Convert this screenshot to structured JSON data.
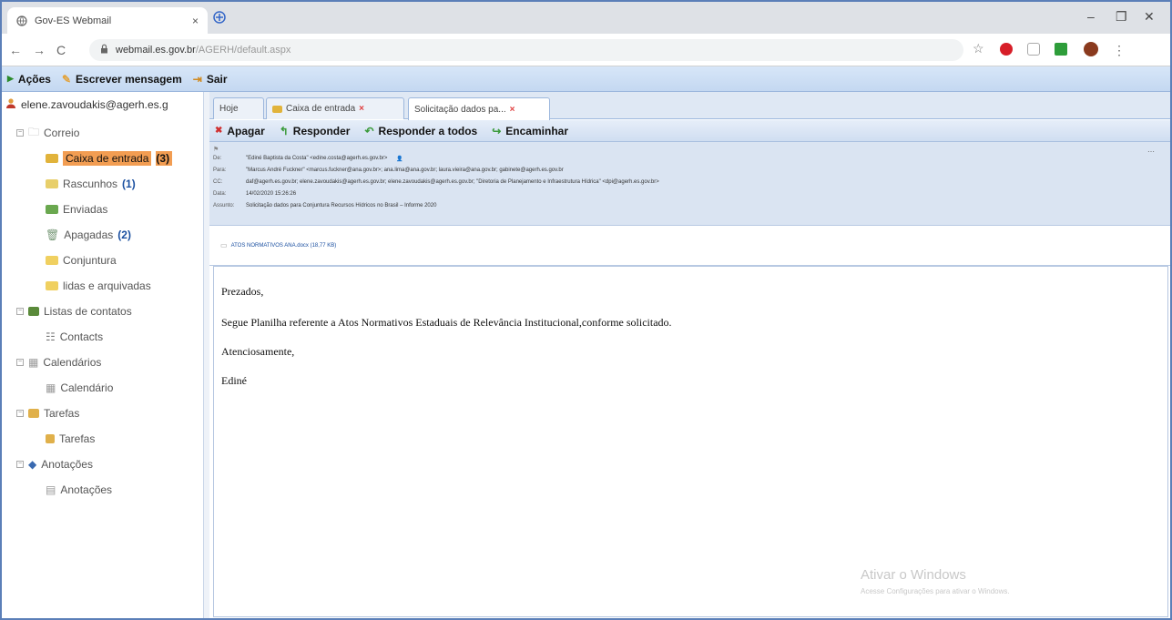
{
  "browser": {
    "tab_title": "Gov-ES Webmail",
    "url_domain": "webmail.es.gov.br",
    "url_path": "/AGERH/default.aspx"
  },
  "toolbar": {
    "actions": "Ações",
    "compose": "Escrever mensagem",
    "logout": "Sair"
  },
  "sidebar": {
    "account": "elene.zavoudakis@agerh.es.g",
    "correio": "Correio",
    "inbox": "Caixa de entrada",
    "inbox_count": "(3)",
    "drafts": "Rascunhos",
    "drafts_count": "(1)",
    "sent": "Enviadas",
    "deleted": "Apagadas",
    "deleted_count": "(2)",
    "conjuntura": "Conjuntura",
    "archived": "lidas e arquivadas",
    "contacts_group": "Listas de contatos",
    "contacts": "Contacts",
    "calendars_group": "Calendários",
    "calendar": "Calendário",
    "tasks_group": "Tarefas",
    "tasks": "Tarefas",
    "notes_group": "Anotações",
    "notes": "Anotações"
  },
  "tabs": {
    "today": "Hoje",
    "inbox": "Caixa de entrada",
    "message": "Solicitação dados pa..."
  },
  "message_toolbar": {
    "delete": "Apagar",
    "reply": "Responder",
    "reply_all": "Responder a todos",
    "forward": "Encaminhar"
  },
  "header": {
    "from_label": "De:",
    "from": "\"Ediné Baptista da Costa\" <edine.costa@agerh.es.gov.br>",
    "to_label": "Para:",
    "to": "\"Marcus André Fuckner\" <marcus.fuckner@ana.gov.br>; ana.lima@ana.gov.br; laura.vieira@ana.gov.br; gabinete@agerh.es.gov.br",
    "cc_label": "CC:",
    "cc": "daf@agerh.es.gov.br; elene.zavoudakis@agerh.es.gov.br; elene.zavoudakis@agerh.es.gov.br; \"Diretoria de Planejamento e Infraestrutura Hídrica\" <dpi@agerh.es.gov.br>",
    "date_label": "Data:",
    "date": "14/02/2020 15:26:26",
    "subject_label": "Assunto:",
    "subject": "Solicitação dados para Conjuntura Recursos Hídricos no Brasil – Informe 2020"
  },
  "attachment": "ATOS NORMATIVOS ANA.docx (18,77 KB)",
  "body": {
    "greeting": "Prezados,",
    "line1": "Segue Planilha  referente a  Atos Normativos Estaduais de Relevância Institucional,conforme solicitado.",
    "closing": "Atenciosamente,",
    "signature": "Ediné"
  },
  "watermark": {
    "title": "Ativar o Windows",
    "subtitle": "Acesse Configurações para ativar o Windows."
  }
}
